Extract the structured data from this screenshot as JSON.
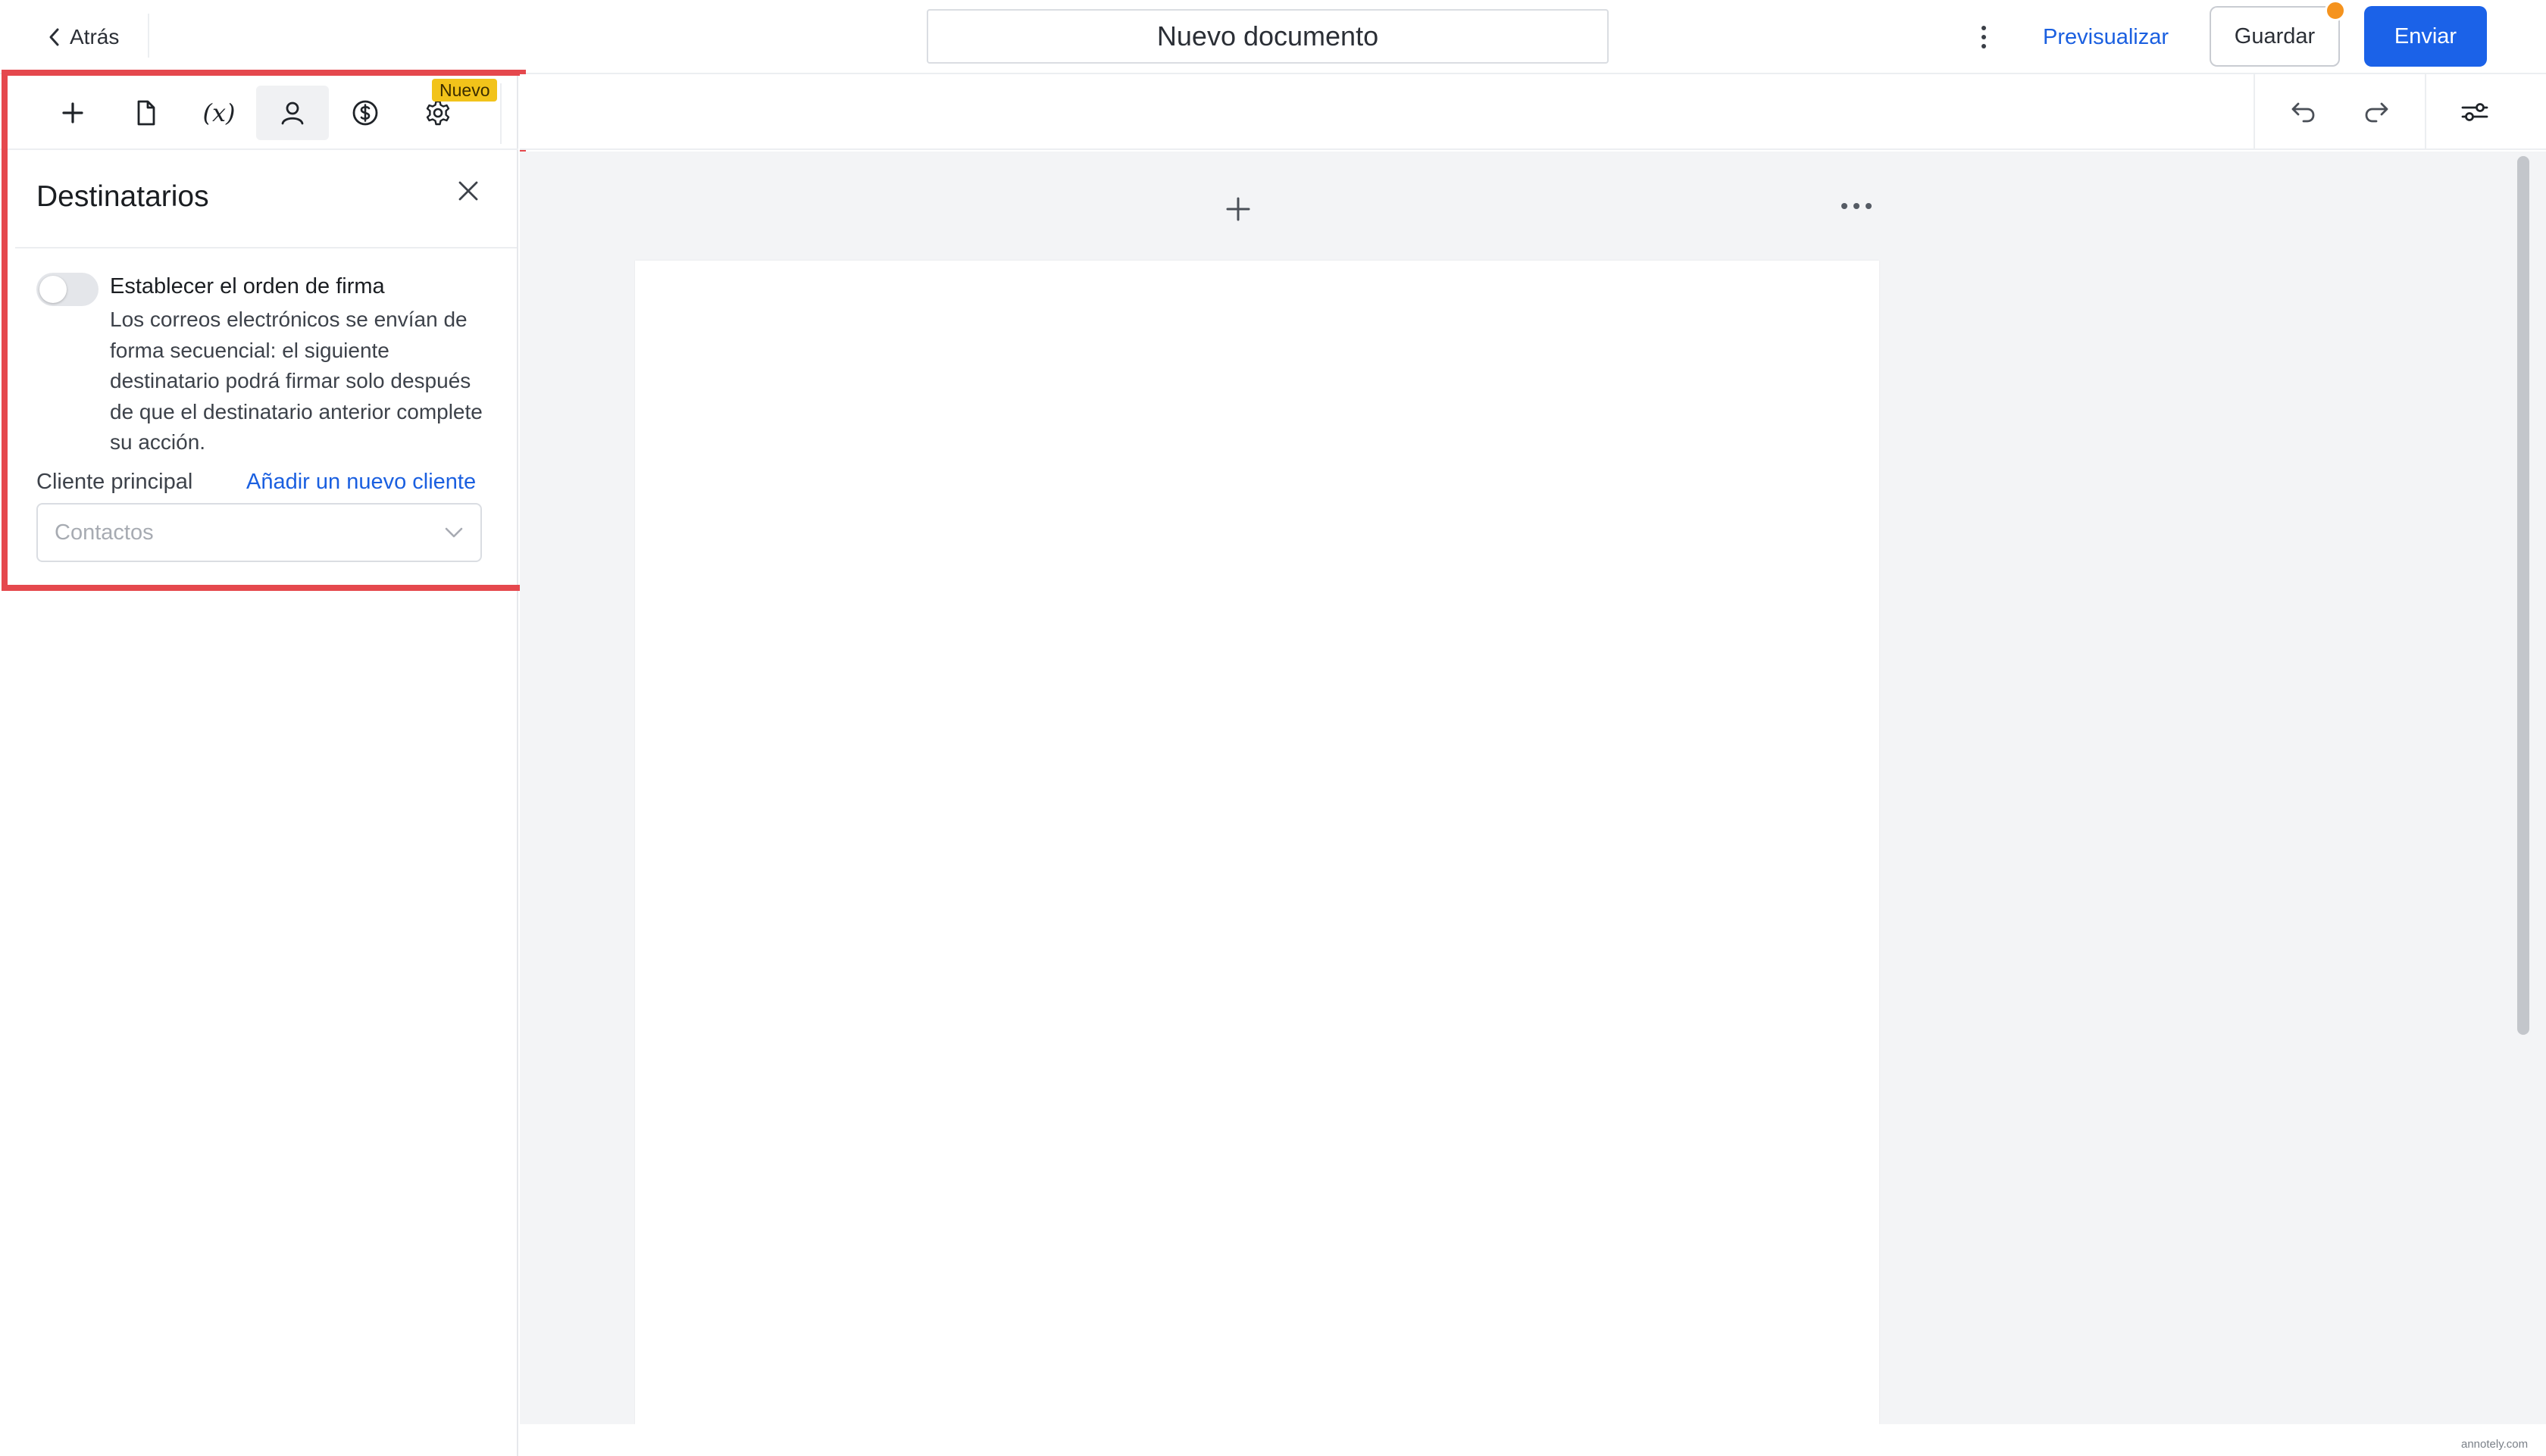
{
  "header": {
    "back_label": "Atrás",
    "document_title": "Nuevo documento",
    "preview_label": "Previsualizar",
    "save_label": "Guardar",
    "send_label": "Enviar"
  },
  "tools": {
    "fx_label": "(x)",
    "new_badge": "Nuevo"
  },
  "recipients_panel": {
    "title": "Destinatarios",
    "signing_order_label": "Establecer el orden de firma",
    "signing_order_enabled": false,
    "signing_order_description": "Los correos electrónicos se envían de forma secuencial: el siguiente destinatario podrá firmar solo después de que el destinatario anterior complete su acción.",
    "main_client_label": "Cliente principal",
    "add_client_link": "Añadir un nuevo cliente",
    "contacts_placeholder": "Contactos"
  },
  "footer": {
    "watermark": "annotely.com"
  },
  "colors": {
    "accent": "#1b62e8",
    "link": "#1a5fe0",
    "badge": "#f2c31a",
    "notification": "#f5931e",
    "highlight": "#e5484d"
  }
}
